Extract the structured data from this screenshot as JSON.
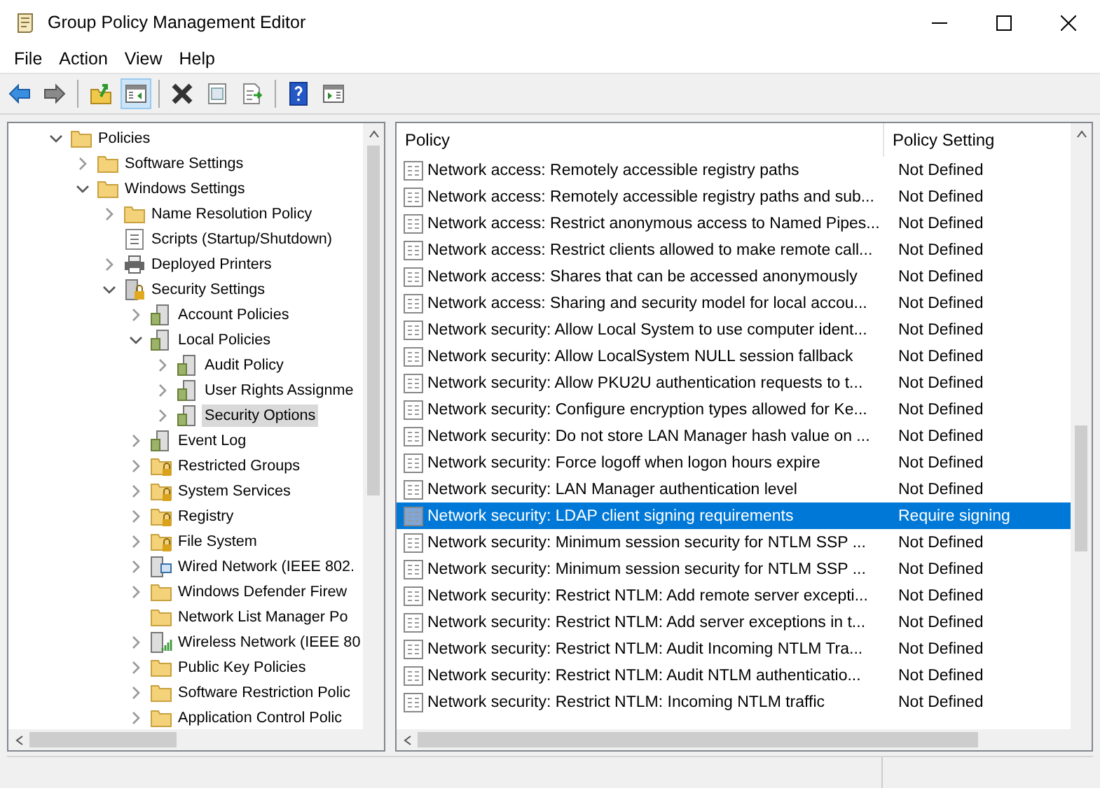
{
  "window": {
    "title": "Group Policy Management Editor"
  },
  "menu": [
    "File",
    "Action",
    "View",
    "Help"
  ],
  "toolbar": [
    {
      "kind": "back",
      "pressed": false
    },
    {
      "kind": "forward",
      "pressed": false
    },
    {
      "kind": "sep"
    },
    {
      "kind": "up",
      "pressed": false
    },
    {
      "kind": "tree",
      "pressed": true
    },
    {
      "kind": "sep"
    },
    {
      "kind": "delete",
      "pressed": false
    },
    {
      "kind": "properties",
      "pressed": false
    },
    {
      "kind": "export",
      "pressed": false
    },
    {
      "kind": "sep"
    },
    {
      "kind": "help",
      "pressed": false
    },
    {
      "kind": "pane",
      "pressed": false
    }
  ],
  "tree": [
    {
      "label": "Policies",
      "kind": "folder",
      "expanded": true,
      "selected": false,
      "children": [
        {
          "label": "Software Settings",
          "kind": "folder",
          "expanded": false,
          "selected": false
        },
        {
          "label": "Windows Settings",
          "kind": "folder",
          "expanded": true,
          "selected": false,
          "children": [
            {
              "label": "Name Resolution Policy",
              "kind": "folder",
              "expanded": false,
              "selected": false
            },
            {
              "label": "Scripts (Startup/Shutdown)",
              "kind": "script",
              "selected": false
            },
            {
              "label": "Deployed Printers",
              "kind": "printer",
              "expanded": false,
              "selected": false
            },
            {
              "label": "Security Settings",
              "kind": "security",
              "expanded": true,
              "selected": false,
              "children": [
                {
                  "label": "Account Policies",
                  "kind": "policy",
                  "expanded": false,
                  "selected": false
                },
                {
                  "label": "Local Policies",
                  "kind": "policy",
                  "expanded": true,
                  "selected": false,
                  "children": [
                    {
                      "label": "Audit Policy",
                      "kind": "policy",
                      "expanded": false,
                      "selected": false
                    },
                    {
                      "label": "User Rights Assignme",
                      "kind": "policy",
                      "expanded": false,
                      "selected": false
                    },
                    {
                      "label": "Security Options",
                      "kind": "policy",
                      "expanded": false,
                      "selected": true
                    }
                  ]
                },
                {
                  "label": "Event Log",
                  "kind": "policy",
                  "expanded": false,
                  "selected": false
                },
                {
                  "label": "Restricted Groups",
                  "kind": "lockfolder",
                  "expanded": false,
                  "selected": false
                },
                {
                  "label": "System Services",
                  "kind": "lockfolder",
                  "expanded": false,
                  "selected": false
                },
                {
                  "label": "Registry",
                  "kind": "lockfolder",
                  "expanded": false,
                  "selected": false
                },
                {
                  "label": "File System",
                  "kind": "lockfolder",
                  "expanded": false,
                  "selected": false
                },
                {
                  "label": "Wired Network (IEEE 802.",
                  "kind": "network",
                  "expanded": false,
                  "selected": false
                },
                {
                  "label": "Windows Defender Firew",
                  "kind": "folder",
                  "expanded": false,
                  "selected": false
                },
                {
                  "label": "Network List Manager Po",
                  "kind": "folder",
                  "selected": false
                },
                {
                  "label": "Wireless Network (IEEE 80",
                  "kind": "wireless",
                  "expanded": false,
                  "selected": false
                },
                {
                  "label": "Public Key Policies",
                  "kind": "folder",
                  "expanded": false,
                  "selected": false
                },
                {
                  "label": "Software Restriction Polic",
                  "kind": "folder",
                  "expanded": false,
                  "selected": false
                },
                {
                  "label": "Application Control Polic",
                  "kind": "folder",
                  "expanded": false,
                  "selected": false
                }
              ]
            }
          ]
        }
      ]
    }
  ],
  "table": {
    "columns": [
      "Policy",
      "Policy Setting"
    ],
    "rows": [
      {
        "policy": "Network access: Remotely accessible registry paths",
        "setting": "Not Defined",
        "selected": false
      },
      {
        "policy": "Network access: Remotely accessible registry paths and sub...",
        "setting": "Not Defined",
        "selected": false
      },
      {
        "policy": "Network access: Restrict anonymous access to Named Pipes...",
        "setting": "Not Defined",
        "selected": false
      },
      {
        "policy": "Network access: Restrict clients allowed to make remote call...",
        "setting": "Not Defined",
        "selected": false
      },
      {
        "policy": "Network access: Shares that can be accessed anonymously",
        "setting": "Not Defined",
        "selected": false
      },
      {
        "policy": "Network access: Sharing and security model for local accou...",
        "setting": "Not Defined",
        "selected": false
      },
      {
        "policy": "Network security: Allow Local System to use computer ident...",
        "setting": "Not Defined",
        "selected": false
      },
      {
        "policy": "Network security: Allow LocalSystem NULL session fallback",
        "setting": "Not Defined",
        "selected": false
      },
      {
        "policy": "Network security: Allow PKU2U authentication requests to t...",
        "setting": "Not Defined",
        "selected": false
      },
      {
        "policy": "Network security: Configure encryption types allowed for Ke...",
        "setting": "Not Defined",
        "selected": false
      },
      {
        "policy": "Network security: Do not store LAN Manager hash value on ...",
        "setting": "Not Defined",
        "selected": false
      },
      {
        "policy": "Network security: Force logoff when logon hours expire",
        "setting": "Not Defined",
        "selected": false
      },
      {
        "policy": "Network security: LAN Manager authentication level",
        "setting": "Not Defined",
        "selected": false
      },
      {
        "policy": "Network security: LDAP client signing requirements",
        "setting": "Require signing",
        "selected": true
      },
      {
        "policy": "Network security: Minimum session security for NTLM SSP ...",
        "setting": "Not Defined",
        "selected": false
      },
      {
        "policy": "Network security: Minimum session security for NTLM SSP ...",
        "setting": "Not Defined",
        "selected": false
      },
      {
        "policy": "Network security: Restrict NTLM: Add remote server excepti...",
        "setting": "Not Defined",
        "selected": false
      },
      {
        "policy": "Network security: Restrict NTLM: Add server exceptions in t...",
        "setting": "Not Defined",
        "selected": false
      },
      {
        "policy": "Network security: Restrict NTLM: Audit Incoming NTLM Tra...",
        "setting": "Not Defined",
        "selected": false
      },
      {
        "policy": "Network security: Restrict NTLM: Audit NTLM authenticatio...",
        "setting": "Not Defined",
        "selected": false
      },
      {
        "policy": "Network security: Restrict NTLM: Incoming NTLM traffic",
        "setting": "Not Defined",
        "selected": false
      }
    ]
  }
}
